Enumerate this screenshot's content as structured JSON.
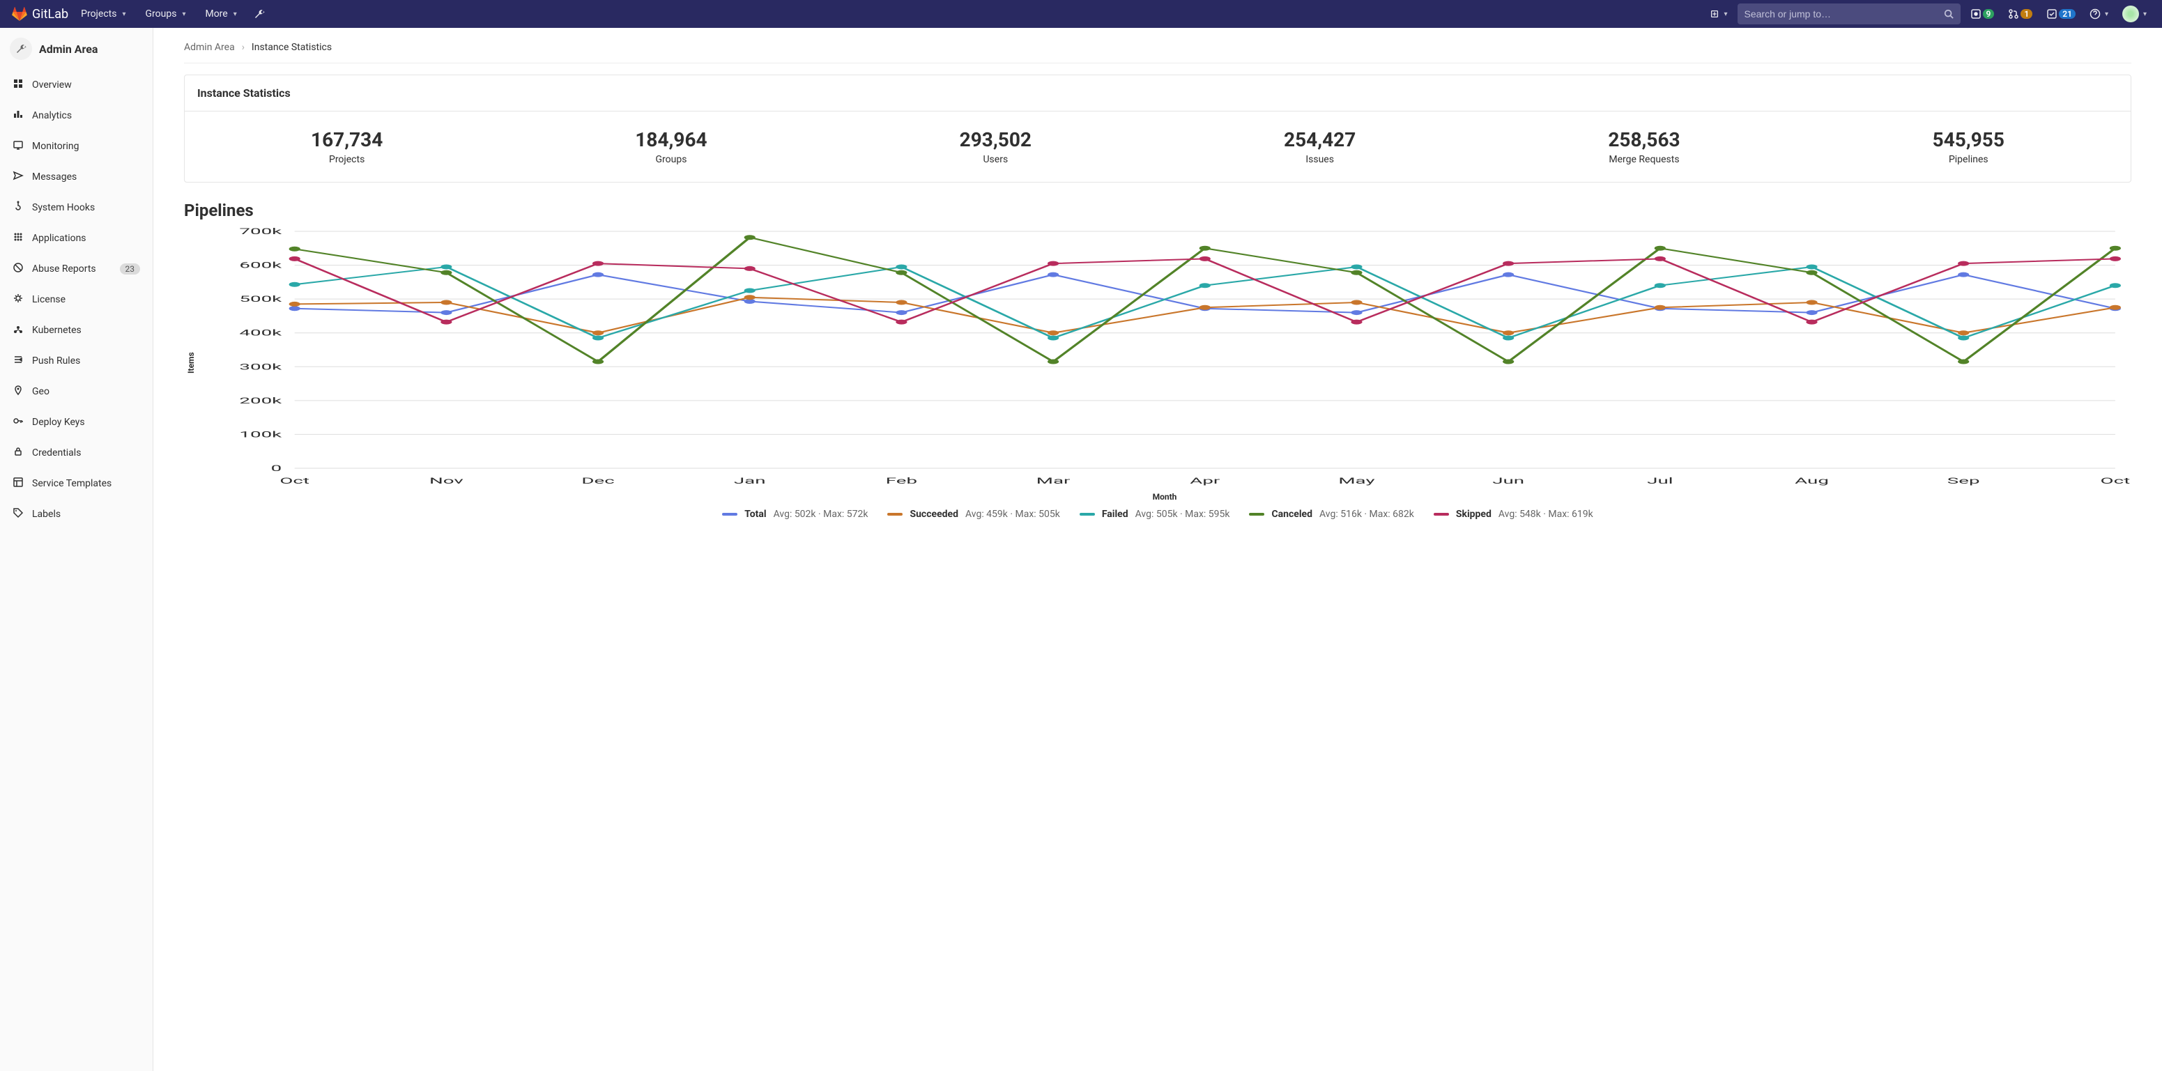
{
  "brand": "GitLab",
  "header": {
    "nav": [
      "Projects",
      "Groups",
      "More"
    ],
    "search_placeholder": "Search or jump to…",
    "issues_badge": "9",
    "mr_badge": "1",
    "todo_badge": "21"
  },
  "sidebar": {
    "title": "Admin Area",
    "items": [
      {
        "label": "Overview",
        "icon": "overview"
      },
      {
        "label": "Analytics",
        "icon": "analytics"
      },
      {
        "label": "Monitoring",
        "icon": "monitoring"
      },
      {
        "label": "Messages",
        "icon": "messages"
      },
      {
        "label": "System Hooks",
        "icon": "hooks"
      },
      {
        "label": "Applications",
        "icon": "apps"
      },
      {
        "label": "Abuse Reports",
        "icon": "abuse",
        "badge": "23"
      },
      {
        "label": "License",
        "icon": "license"
      },
      {
        "label": "Kubernetes",
        "icon": "k8s"
      },
      {
        "label": "Push Rules",
        "icon": "push"
      },
      {
        "label": "Geo",
        "icon": "geo"
      },
      {
        "label": "Deploy Keys",
        "icon": "key"
      },
      {
        "label": "Credentials",
        "icon": "lock"
      },
      {
        "label": "Service Templates",
        "icon": "template"
      },
      {
        "label": "Labels",
        "icon": "labels"
      }
    ]
  },
  "breadcrumb": {
    "root": "Admin Area",
    "current": "Instance Statistics"
  },
  "card_title": "Instance Statistics",
  "stats": [
    {
      "value": "167,734",
      "label": "Projects"
    },
    {
      "value": "184,964",
      "label": "Groups"
    },
    {
      "value": "293,502",
      "label": "Users"
    },
    {
      "value": "254,427",
      "label": "Issues"
    },
    {
      "value": "258,563",
      "label": "Merge Requests"
    },
    {
      "value": "545,955",
      "label": "Pipelines"
    }
  ],
  "section_title": "Pipelines",
  "legend": [
    {
      "name": "Total",
      "sub": "Avg: 502k · Max: 572k",
      "color": "#617ae2"
    },
    {
      "name": "Succeeded",
      "sub": "Avg: 459k · Max: 505k",
      "color": "#c9762b"
    },
    {
      "name": "Failed",
      "sub": "Avg: 505k · Max: 595k",
      "color": "#2aa8a8"
    },
    {
      "name": "Canceled",
      "sub": "Avg: 516k · Max: 682k",
      "color": "#528328"
    },
    {
      "name": "Skipped",
      "sub": "Avg: 548k · Max: 619k",
      "color": "#b82c5d"
    }
  ],
  "chart_data": {
    "type": "line",
    "title": "Pipelines",
    "xlabel": "Month",
    "ylabel": "Items",
    "ylim": [
      0,
      700000
    ],
    "y_ticks": [
      "0",
      "100k",
      "200k",
      "300k",
      "400k",
      "500k",
      "600k",
      "700k"
    ],
    "categories": [
      "Oct",
      "Nov",
      "Dec",
      "Jan",
      "Feb",
      "Mar",
      "Apr",
      "May",
      "Jun",
      "Jul",
      "Aug",
      "Sep",
      "Oct"
    ],
    "series": [
      {
        "name": "Total",
        "color": "#617ae2",
        "values": [
          472000,
          460000,
          572000,
          493000,
          460000,
          572000,
          472000,
          460000,
          572000,
          472000,
          460000,
          572000,
          472000
        ]
      },
      {
        "name": "Succeeded",
        "color": "#c9762b",
        "values": [
          485000,
          490000,
          400000,
          505000,
          490000,
          400000,
          475000,
          490000,
          400000,
          475000,
          490000,
          400000,
          475000
        ]
      },
      {
        "name": "Failed",
        "color": "#2aa8a8",
        "values": [
          543000,
          595000,
          385000,
          525000,
          595000,
          385000,
          540000,
          595000,
          385000,
          540000,
          595000,
          385000,
          540000
        ]
      },
      {
        "name": "Canceled",
        "color": "#528328",
        "values": [
          648000,
          578000,
          315000,
          682000,
          578000,
          315000,
          650000,
          578000,
          315000,
          650000,
          578000,
          315000,
          650000
        ]
      },
      {
        "name": "Skipped",
        "color": "#b82c5d",
        "values": [
          619000,
          432000,
          605000,
          590000,
          432000,
          605000,
          619000,
          432000,
          605000,
          619000,
          432000,
          605000,
          619000
        ]
      }
    ]
  }
}
